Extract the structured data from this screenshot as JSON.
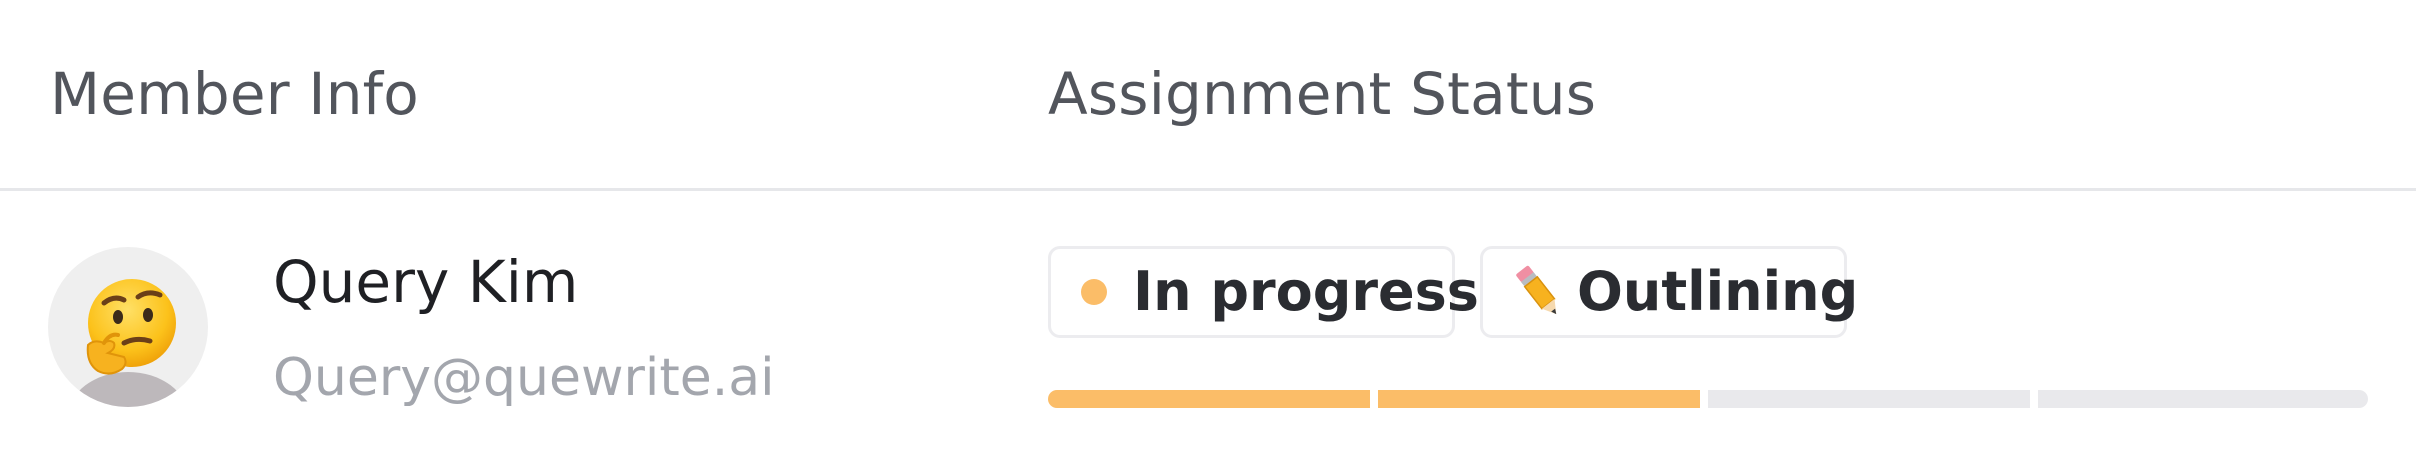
{
  "table": {
    "headers": {
      "member_info": "Member Info",
      "assignment_status": "Assignment Status"
    },
    "rows": [
      {
        "member": {
          "name": "Query Kim",
          "email": "Query@quewrite.ai",
          "avatar_icon": "thinking-face-emoji"
        },
        "status": {
          "label": "In progress",
          "dot_color": "#fbbd68",
          "stage_icon": "pencil-icon",
          "stage_label": "Outlining",
          "progress": {
            "completed_steps": 2,
            "total_steps": 4,
            "filled_color": "#fbbd68",
            "empty_color": "#e9e9ec"
          }
        }
      }
    ]
  }
}
